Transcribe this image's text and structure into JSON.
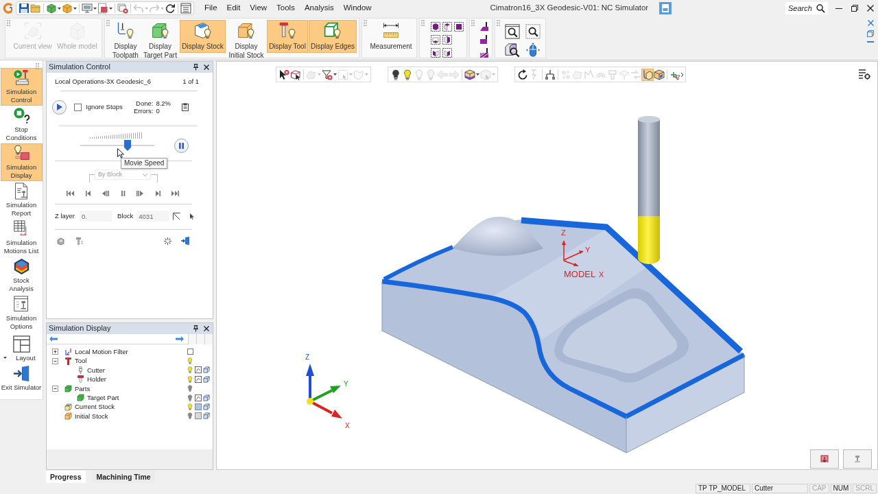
{
  "title_bar": {
    "quick_access": [
      {
        "disabled": false
      },
      {
        "disabled": false
      },
      {
        "disabled": false
      },
      {
        "disabled": false
      },
      {
        "disabled": false
      },
      {
        "disabled": false
      },
      {
        "disabled": false
      },
      {
        "disabled": true
      },
      {
        "disabled": true
      },
      {
        "disabled": false
      },
      {
        "disabled": false
      }
    ],
    "menus": [
      "File",
      "Edit",
      "View",
      "Tools",
      "Analysis",
      "Window"
    ],
    "title": "Cimatron16_3X Geodesic-V01: NC Simulator",
    "search": {
      "placeholder": "Search"
    }
  },
  "ribbon": {
    "groups": [
      {
        "buttons": [
          {
            "label": "Current view",
            "selected": false,
            "disabled": true
          },
          {
            "label": "Whole model",
            "selected": false,
            "disabled": true
          }
        ]
      },
      {
        "buttons": [
          {
            "label": "Display Toolpath",
            "selected": false,
            "disabled": false
          },
          {
            "label": "Display Target Part",
            "selected": false,
            "disabled": false
          },
          {
            "label": "Display Stock",
            "selected": true,
            "disabled": false
          },
          {
            "label": "Display Initial Stock",
            "selected": false,
            "disabled": false
          },
          {
            "label": "Display Tool",
            "selected": true,
            "disabled": false
          },
          {
            "label": "Display Edges",
            "selected": true,
            "disabled": false
          }
        ]
      },
      {
        "buttons": [
          {
            "label": "Measurement",
            "selected": false,
            "disabled": false
          }
        ]
      }
    ]
  },
  "side_toolbar": {
    "items": [
      {
        "label": "Simulation Control",
        "selected": true
      },
      {
        "label": "Stop Conditions",
        "selected": false
      },
      {
        "label": "Simulation Display",
        "selected": true
      },
      {
        "label": "Simulation Report",
        "selected": false
      },
      {
        "label": "Simulation Motions List",
        "selected": false
      },
      {
        "label": "Stock Analysis",
        "selected": false
      },
      {
        "label": "Simulation Options",
        "selected": false
      },
      {
        "label": "Layout",
        "selected": false
      },
      {
        "label": "Exit Simulator",
        "selected": false
      }
    ]
  },
  "simulation_control": {
    "title": "Simulation Control",
    "operation": "Local Operations-3X Geodesic_6",
    "counter": "1 of 1",
    "ignore_stops": {
      "label": "Ignore Stops",
      "checked": false
    },
    "done": {
      "label": "Done:",
      "value": "8.2%"
    },
    "errors": {
      "label": "Errors:",
      "value": "0"
    },
    "movie_speed": {
      "level": 0.64,
      "tooltip": "Movie Speed"
    },
    "step_mode": {
      "value": "By Block",
      "disabled": true
    },
    "z_layer": {
      "label": "Z layer",
      "value": "0."
    },
    "block": {
      "label": "Block",
      "value": "4031"
    }
  },
  "simulation_display": {
    "title": "Simulation Display",
    "tree": [
      {
        "label": "Local Motion Filter",
        "kind": "filter",
        "expanded": false,
        "checked": false
      },
      {
        "label": "Tool",
        "kind": "tool",
        "expanded": true,
        "on": true,
        "children": [
          {
            "label": "Cutter",
            "kind": "cutter",
            "on": true
          },
          {
            "label": "Holder",
            "kind": "holder",
            "on": true
          }
        ]
      },
      {
        "label": "Parts",
        "kind": "group",
        "expanded": true,
        "on": false,
        "children": [
          {
            "label": "Target Part",
            "kind": "part",
            "on": false
          }
        ]
      },
      {
        "label": "Current Stock",
        "kind": "stock",
        "on": true,
        "color": "#a9c3ee"
      },
      {
        "label": "Initial Stock",
        "kind": "rawstock",
        "on": false,
        "color": "#d9d9d9"
      }
    ]
  },
  "bottom_tabs": [
    {
      "label": "Progress",
      "selected": true
    },
    {
      "label": "Machining Time",
      "selected": false
    }
  ],
  "viewport": {
    "toolbars": [
      {
        "buttons": [
          {
            "selected": false,
            "disabled": false
          },
          {
            "selected": false,
            "disabled": false
          },
          {
            "selected": false,
            "disabled": true
          },
          {
            "selected": false,
            "disabled": false
          },
          {
            "selected": false,
            "disabled": true
          },
          {
            "selected": false,
            "disabled": true
          }
        ]
      },
      {
        "buttons": [
          {
            "selected": false,
            "disabled": false
          },
          {
            "selected": false,
            "disabled": false
          },
          {
            "selected": false,
            "disabled": true
          },
          {
            "selected": false,
            "disabled": true
          },
          {
            "selected": false,
            "disabled": true
          },
          {
            "selected": false,
            "disabled": true
          },
          {
            "selected": false,
            "disabled": false
          },
          {
            "selected": false,
            "disabled": true
          }
        ]
      },
      {
        "buttons": [
          {
            "selected": false,
            "disabled": false
          },
          {
            "selected": false,
            "disabled": true
          },
          {
            "selected": false,
            "disabled": false
          },
          {
            "selected": false,
            "disabled": true
          },
          {
            "selected": false,
            "disabled": true
          },
          {
            "selected": false,
            "disabled": true
          },
          {
            "selected": false,
            "disabled": true
          },
          {
            "selected": false,
            "disabled": true
          },
          {
            "selected": false,
            "disabled": true
          },
          {
            "selected": false,
            "disabled": true
          },
          {
            "selected": true,
            "disabled": false
          },
          {
            "selected": false,
            "disabled": false
          },
          {
            "selected": false,
            "disabled": false
          }
        ]
      }
    ],
    "model_axes": {
      "z": "Z",
      "y": "Y",
      "x": "X",
      "label": "MODEL"
    },
    "view_axes": {
      "z": "Z",
      "y": "Y",
      "x": "X"
    }
  },
  "status_bar": {
    "fields": [
      "TP TP_MODEL",
      "Cutter"
    ],
    "indicators": [
      {
        "label": "CAP",
        "on": false
      },
      {
        "label": "NUM",
        "on": true
      },
      {
        "label": "SCRL",
        "on": false
      }
    ]
  }
}
